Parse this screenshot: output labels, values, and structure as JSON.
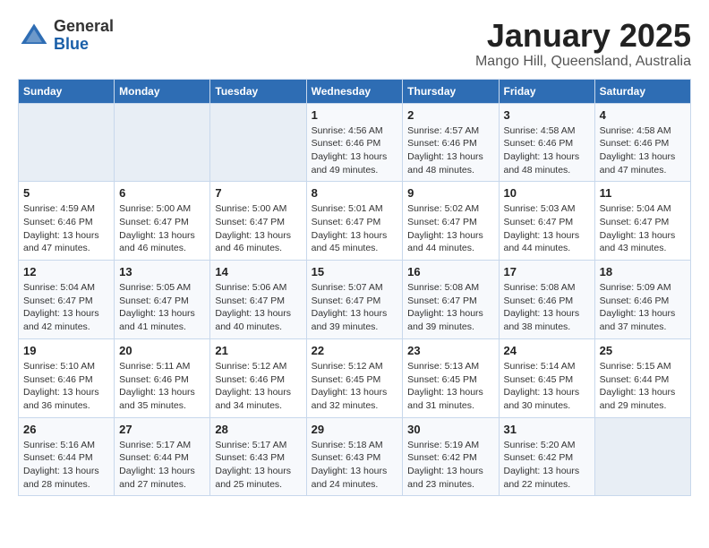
{
  "logo": {
    "general": "General",
    "blue": "Blue"
  },
  "header": {
    "title": "January 2025",
    "location": "Mango Hill, Queensland, Australia"
  },
  "days_of_week": [
    "Sunday",
    "Monday",
    "Tuesday",
    "Wednesday",
    "Thursday",
    "Friday",
    "Saturday"
  ],
  "weeks": [
    [
      {
        "day": "",
        "info": ""
      },
      {
        "day": "",
        "info": ""
      },
      {
        "day": "",
        "info": ""
      },
      {
        "day": "1",
        "info": "Sunrise: 4:56 AM\nSunset: 6:46 PM\nDaylight: 13 hours\nand 49 minutes."
      },
      {
        "day": "2",
        "info": "Sunrise: 4:57 AM\nSunset: 6:46 PM\nDaylight: 13 hours\nand 48 minutes."
      },
      {
        "day": "3",
        "info": "Sunrise: 4:58 AM\nSunset: 6:46 PM\nDaylight: 13 hours\nand 48 minutes."
      },
      {
        "day": "4",
        "info": "Sunrise: 4:58 AM\nSunset: 6:46 PM\nDaylight: 13 hours\nand 47 minutes."
      }
    ],
    [
      {
        "day": "5",
        "info": "Sunrise: 4:59 AM\nSunset: 6:46 PM\nDaylight: 13 hours\nand 47 minutes."
      },
      {
        "day": "6",
        "info": "Sunrise: 5:00 AM\nSunset: 6:47 PM\nDaylight: 13 hours\nand 46 minutes."
      },
      {
        "day": "7",
        "info": "Sunrise: 5:00 AM\nSunset: 6:47 PM\nDaylight: 13 hours\nand 46 minutes."
      },
      {
        "day": "8",
        "info": "Sunrise: 5:01 AM\nSunset: 6:47 PM\nDaylight: 13 hours\nand 45 minutes."
      },
      {
        "day": "9",
        "info": "Sunrise: 5:02 AM\nSunset: 6:47 PM\nDaylight: 13 hours\nand 44 minutes."
      },
      {
        "day": "10",
        "info": "Sunrise: 5:03 AM\nSunset: 6:47 PM\nDaylight: 13 hours\nand 44 minutes."
      },
      {
        "day": "11",
        "info": "Sunrise: 5:04 AM\nSunset: 6:47 PM\nDaylight: 13 hours\nand 43 minutes."
      }
    ],
    [
      {
        "day": "12",
        "info": "Sunrise: 5:04 AM\nSunset: 6:47 PM\nDaylight: 13 hours\nand 42 minutes."
      },
      {
        "day": "13",
        "info": "Sunrise: 5:05 AM\nSunset: 6:47 PM\nDaylight: 13 hours\nand 41 minutes."
      },
      {
        "day": "14",
        "info": "Sunrise: 5:06 AM\nSunset: 6:47 PM\nDaylight: 13 hours\nand 40 minutes."
      },
      {
        "day": "15",
        "info": "Sunrise: 5:07 AM\nSunset: 6:47 PM\nDaylight: 13 hours\nand 39 minutes."
      },
      {
        "day": "16",
        "info": "Sunrise: 5:08 AM\nSunset: 6:47 PM\nDaylight: 13 hours\nand 39 minutes."
      },
      {
        "day": "17",
        "info": "Sunrise: 5:08 AM\nSunset: 6:46 PM\nDaylight: 13 hours\nand 38 minutes."
      },
      {
        "day": "18",
        "info": "Sunrise: 5:09 AM\nSunset: 6:46 PM\nDaylight: 13 hours\nand 37 minutes."
      }
    ],
    [
      {
        "day": "19",
        "info": "Sunrise: 5:10 AM\nSunset: 6:46 PM\nDaylight: 13 hours\nand 36 minutes."
      },
      {
        "day": "20",
        "info": "Sunrise: 5:11 AM\nSunset: 6:46 PM\nDaylight: 13 hours\nand 35 minutes."
      },
      {
        "day": "21",
        "info": "Sunrise: 5:12 AM\nSunset: 6:46 PM\nDaylight: 13 hours\nand 34 minutes."
      },
      {
        "day": "22",
        "info": "Sunrise: 5:12 AM\nSunset: 6:45 PM\nDaylight: 13 hours\nand 32 minutes."
      },
      {
        "day": "23",
        "info": "Sunrise: 5:13 AM\nSunset: 6:45 PM\nDaylight: 13 hours\nand 31 minutes."
      },
      {
        "day": "24",
        "info": "Sunrise: 5:14 AM\nSunset: 6:45 PM\nDaylight: 13 hours\nand 30 minutes."
      },
      {
        "day": "25",
        "info": "Sunrise: 5:15 AM\nSunset: 6:44 PM\nDaylight: 13 hours\nand 29 minutes."
      }
    ],
    [
      {
        "day": "26",
        "info": "Sunrise: 5:16 AM\nSunset: 6:44 PM\nDaylight: 13 hours\nand 28 minutes."
      },
      {
        "day": "27",
        "info": "Sunrise: 5:17 AM\nSunset: 6:44 PM\nDaylight: 13 hours\nand 27 minutes."
      },
      {
        "day": "28",
        "info": "Sunrise: 5:17 AM\nSunset: 6:43 PM\nDaylight: 13 hours\nand 25 minutes."
      },
      {
        "day": "29",
        "info": "Sunrise: 5:18 AM\nSunset: 6:43 PM\nDaylight: 13 hours\nand 24 minutes."
      },
      {
        "day": "30",
        "info": "Sunrise: 5:19 AM\nSunset: 6:42 PM\nDaylight: 13 hours\nand 23 minutes."
      },
      {
        "day": "31",
        "info": "Sunrise: 5:20 AM\nSunset: 6:42 PM\nDaylight: 13 hours\nand 22 minutes."
      },
      {
        "day": "",
        "info": ""
      }
    ]
  ]
}
